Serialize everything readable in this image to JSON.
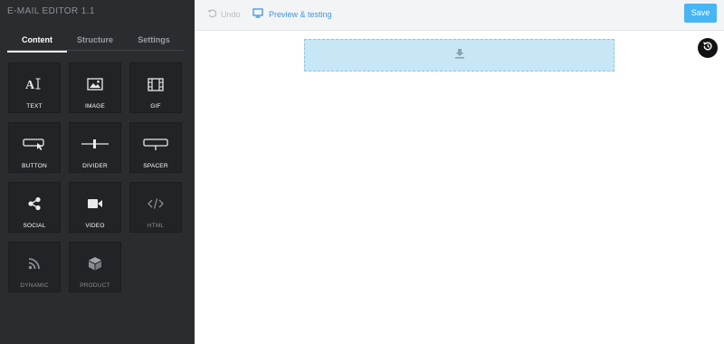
{
  "app": {
    "title": "E-MAIL EDITOR 1.1"
  },
  "sidebar": {
    "tabs": [
      {
        "label": "Content"
      },
      {
        "label": "Structure"
      },
      {
        "label": "Settings"
      }
    ],
    "active_tab": "Content",
    "blocks": [
      {
        "label": "TEXT",
        "icon": "text-icon"
      },
      {
        "label": "IMAGE",
        "icon": "image-icon"
      },
      {
        "label": "GIF",
        "icon": "film-icon"
      },
      {
        "label": "BUTTON",
        "icon": "button-icon"
      },
      {
        "label": "DIVIDER",
        "icon": "divider-icon"
      },
      {
        "label": "SPACER",
        "icon": "spacer-icon"
      },
      {
        "label": "SOCIAL",
        "icon": "share-icon"
      },
      {
        "label": "VIDEO",
        "icon": "video-icon"
      },
      {
        "label": "HTML",
        "icon": "code-icon"
      },
      {
        "label": "DYNAMIC",
        "icon": "rss-icon"
      },
      {
        "label": "PRODUCT",
        "icon": "box-icon"
      }
    ]
  },
  "toolbar": {
    "undo_label": "Undo",
    "preview_label": "Preview & testing",
    "save_label": "Save"
  },
  "colors": {
    "sidebar_bg": "#2b2c30",
    "accent": "#48b5f5",
    "link": "#3f96dc",
    "drop_zone": "#c7e6f6"
  }
}
